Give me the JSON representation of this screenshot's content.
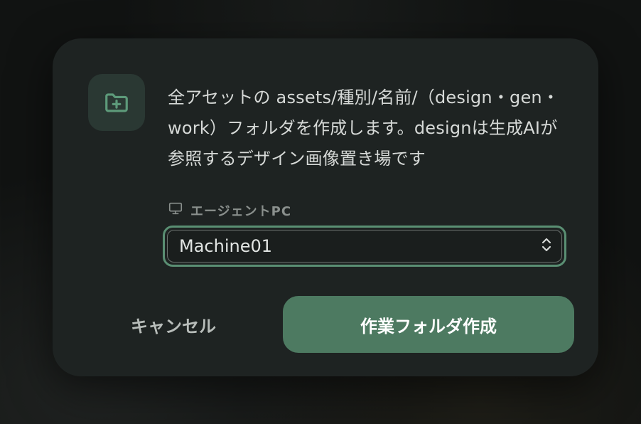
{
  "dialog": {
    "icon": "folder-plus-icon",
    "message": "全アセットの assets/種別/名前/（design・gen・work）フォルダを作成します。designは生成AIが参照するデザイン画像置き場です",
    "field_label": "エージェントPC",
    "field_icon": "monitor-icon",
    "select_value": "Machine01",
    "cancel_label": "キャンセル",
    "confirm_label": "作業フォルダ作成"
  },
  "colors": {
    "accent": "#4d7a61",
    "focus_ring": "#5a8f73",
    "dialog_bg": "#1e2322"
  }
}
